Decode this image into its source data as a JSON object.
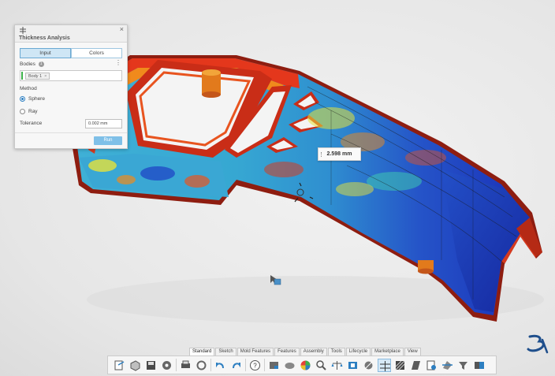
{
  "panel": {
    "title": "Thickness Analysis",
    "close_glyph": "×",
    "tabs": [
      {
        "label": "Input",
        "active": true
      },
      {
        "label": "Colors",
        "active": false
      }
    ],
    "bodies_label": "Bodies",
    "bodies_count": "1",
    "more_glyph": "⋮",
    "body_chip": "Body 1",
    "chip_remove": "×",
    "method_label": "Method",
    "method_options": [
      {
        "label": "Sphere",
        "selected": true
      },
      {
        "label": "Ray",
        "selected": false
      }
    ],
    "tolerance_label": "Tolerance",
    "tolerance_value": "0.002 mm",
    "run_label": "Run"
  },
  "measurement": {
    "value": "2.598 mm"
  },
  "action_bar": {
    "tabs": [
      {
        "label": "Standard",
        "active": true
      },
      {
        "label": "Sketch",
        "active": false
      },
      {
        "label": "Mold Features",
        "active": false
      },
      {
        "label": "Features",
        "active": false
      },
      {
        "label": "Assembly",
        "active": false
      },
      {
        "label": "Tools",
        "active": false
      },
      {
        "label": "Lifecycle",
        "active": false
      },
      {
        "label": "Marketplace",
        "active": false
      },
      {
        "label": "View",
        "active": false
      }
    ],
    "icons": [
      "share-icon",
      "new-part-icon",
      "save-icon",
      "settings-gear-icon",
      "print-icon",
      "options-icon",
      "undo-icon",
      "redo-icon",
      "help-icon",
      "render-icon",
      "appearance-icon",
      "color-wheel-icon",
      "inspect-icon",
      "balance-icon",
      "thickness-icon",
      "measure-icon",
      "thickness-analysis-icon",
      "hatch-icon",
      "draft-icon",
      "mass-icon",
      "section-icon",
      "filter-icon",
      "compare-icon"
    ]
  },
  "colors": {
    "accent": "#2d7fc1",
    "run_button": "#7fc0e8",
    "thick_red": "#d63a1f",
    "thick_orange": "#f08a1c",
    "thick_yellow": "#e6e23a",
    "thick_cyan": "#3fb8d8",
    "thick_blue": "#1d3fc4"
  }
}
